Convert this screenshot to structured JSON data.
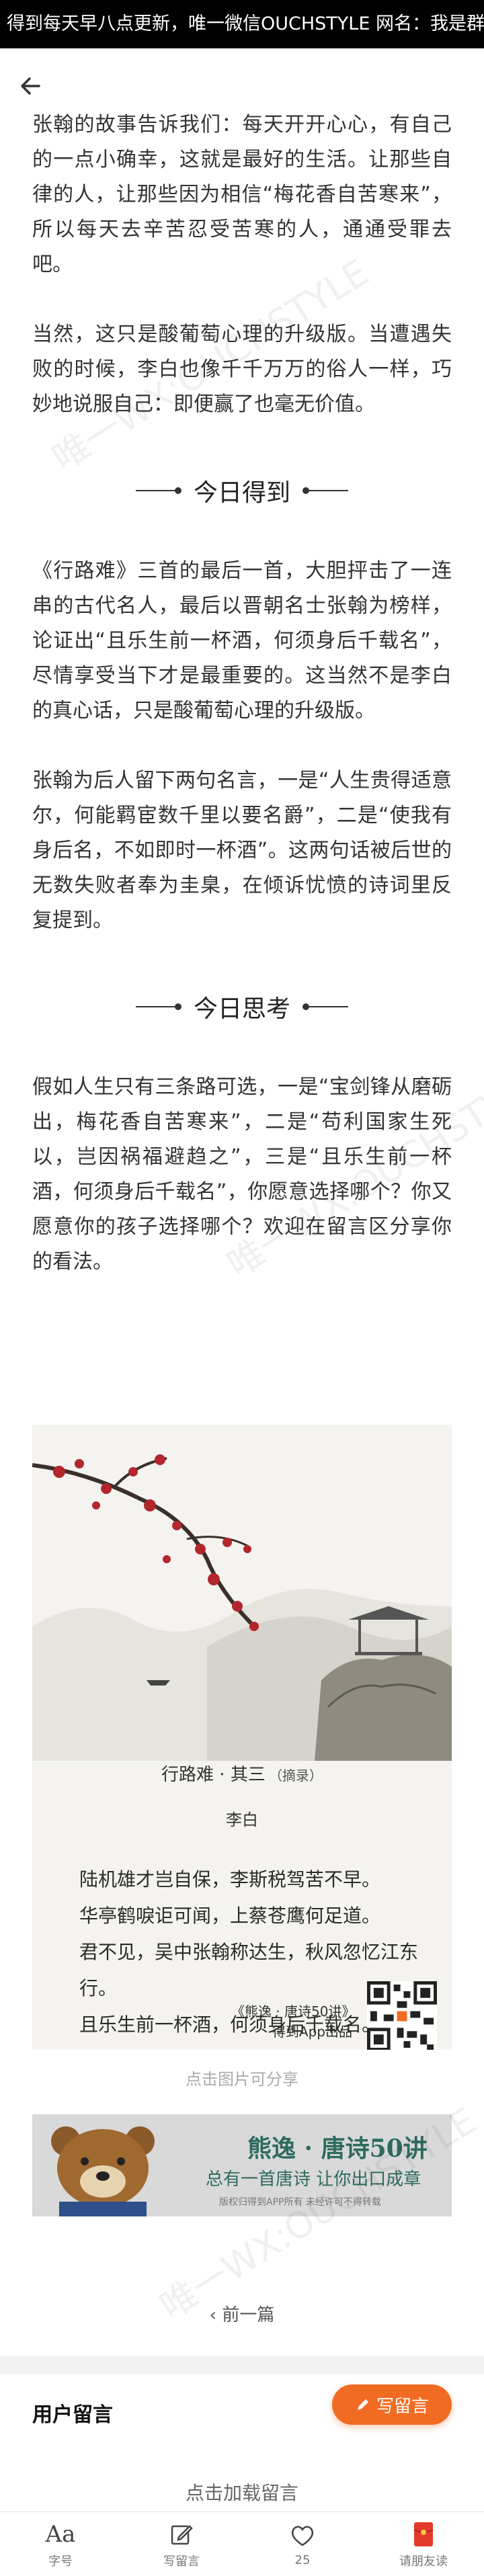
{
  "status_bar": {
    "text": "得到每天早八点更新，唯一微信OUCHSTYLE 网名：我是群主"
  },
  "article": {
    "paragraphs_1": [
      "张翰的故事告诉我们：每天开开心心，有自己的一点小确幸，这就是最好的生活。让那些自律的人，让那些因为相信“梅花香自苦寒来”，所以每天去辛苦忍受苦寒的人，通通受罪去吧。",
      "当然，这只是酸葡萄心理的升级版。当遭遇失败的时候，李白也像千千万万的俗人一样，巧妙地说服自己：即便赢了也毫无价值。"
    ],
    "section_1": "今日得到",
    "paragraphs_2": [
      "《行路难》三首的最后一首，大胆抨击了一连串的古代名人，最后以晋朝名士张翰为榜样，论证出“且乐生前一杯酒，何须身后千载名”，尽情享受当下才是最重要的。这当然不是李白的真心话，只是酸葡萄心理的升级版。",
      "张翰为后人留下两句名言，一是“人生贵得适意尔，何能羁宦数千里以要名爵”，二是“使我有身后名，不如即时一杯酒”。这两句话被后世的无数失败者奉为圭臬，在倾诉忧愤的诗词里反复提到。"
    ],
    "section_2": "今日思考",
    "paragraphs_3": [
      "假如人生只有三条路可选，一是“宝剑锋从磨砺出，梅花香自苦寒来”，二是“苟利国家生死以，岂因祸福避趋之”，三是“且乐生前一杯酒，何须身后千载名”，你愿意选择哪个？你又愿意你的孩子选择哪个？欢迎在留言区分享你的看法。"
    ]
  },
  "poem_card": {
    "title": "行路难 · 其三",
    "subtitle": "（摘录）",
    "author": "李白",
    "lines": [
      "陆机雄才岂自保，李斯税驾苦不早。",
      "华亭鹤唳讵可闻，上蔡苍鹰何足道。",
      "君不见，吴中张翰称达生，秋风忽忆江东行。",
      "且乐生前一杯酒，何须身后千载名。"
    ],
    "footer_line1": "《熊逸 · 唐诗50讲》",
    "footer_line2": "得到App出品"
  },
  "share_tip": "点击图片可分享",
  "banner": {
    "title": "熊逸 · 唐诗50讲",
    "slogan": "总有一首唐诗 让你出口成章",
    "copyright": "版权归得到APP所有 未经许可不得转载"
  },
  "prev_link": "‹ 前一篇",
  "comments": {
    "title": "用户留言",
    "write_button": "写留言",
    "load_more": "点击加载留言"
  },
  "tabbar": [
    {
      "label": "字号",
      "icon": "font-size-icon"
    },
    {
      "label": "写留言",
      "icon": "edit-icon"
    },
    {
      "label": "25",
      "icon": "heart-icon"
    },
    {
      "label": "请朋友读",
      "icon": "red-envelope-icon"
    }
  ],
  "watermark": "唯一WX:OUCHSTYLE",
  "colors": {
    "accent": "#f26b22",
    "banner_text": "#2e6b5e"
  }
}
